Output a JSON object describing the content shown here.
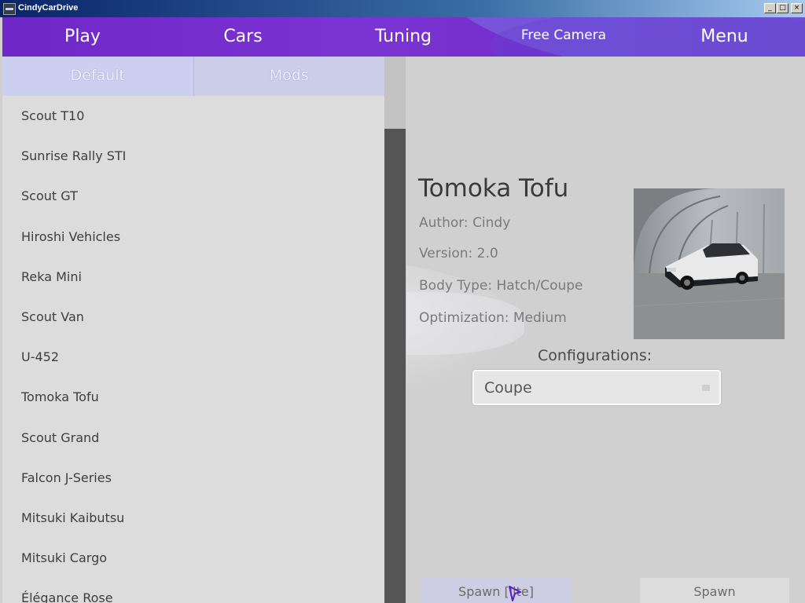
{
  "window": {
    "title": "CindyCarDrive",
    "controls": [
      "_",
      "□",
      "×"
    ]
  },
  "nav": {
    "play": "Play",
    "cars": "Cars",
    "tuning": "Tuning",
    "free_camera": "Free Camera",
    "menu": "Menu"
  },
  "tabs": {
    "default": "Default",
    "mods": "Mods"
  },
  "car_list": [
    "Scout T10",
    "Sunrise Rally STI",
    "Scout GT",
    "Hiroshi Vehicles",
    "Reka Mini",
    "Scout Van",
    "U-452",
    "Tomoka Tofu",
    "Scout Grand",
    "Falcon J-Series",
    "Mitsuki Kaibutsu",
    "Mitsuki Cargo",
    "Élégance Rose"
  ],
  "details": {
    "name": "Tomoka Tofu",
    "author": "Author: Cindy",
    "version": "Version: 2.0",
    "body_type": "Body Type: Hatch/Coupe",
    "optimization": "Optimization: Medium",
    "configurations_label": "Configurations:",
    "configuration_value": "Coupe"
  },
  "buttons": {
    "spawn_lite": "Spawn [lite]",
    "spawn": "Spawn"
  },
  "colors": {
    "accent": "#6f27c8",
    "tab_bg": "#cccff0"
  },
  "icons": {
    "app": "app-icon",
    "preview": "car-preview-image",
    "cursor": "mouse-cursor-icon"
  }
}
